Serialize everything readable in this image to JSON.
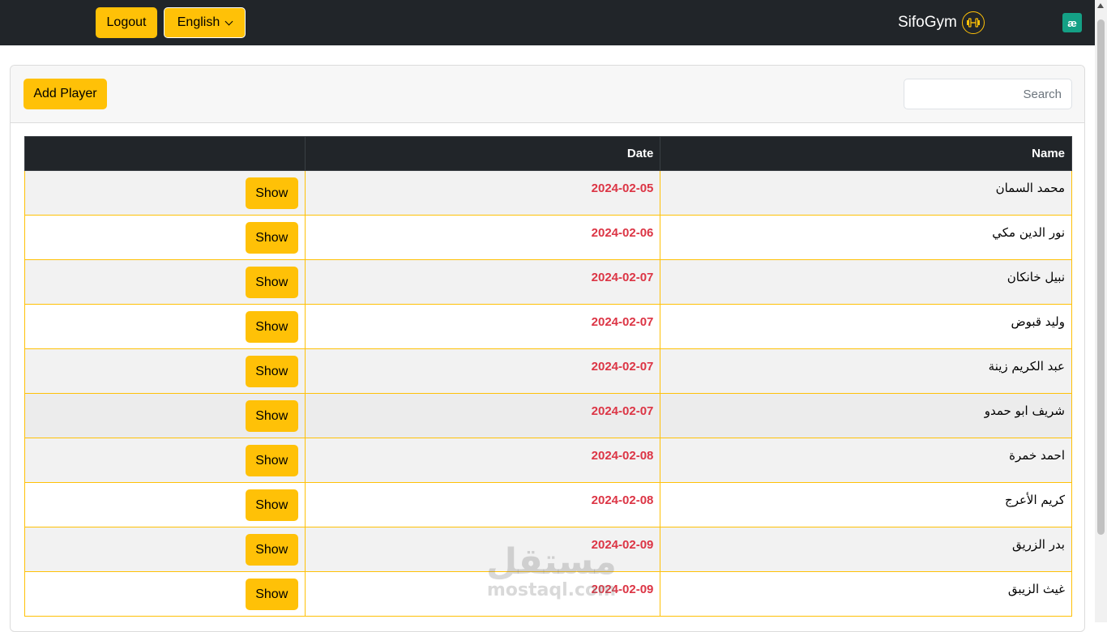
{
  "navbar": {
    "logout_label": "Logout",
    "language_label": "English",
    "brand_name": "SifoGym",
    "brand_icon": "dumbbell-icon",
    "corner_icon": "extension-icon"
  },
  "toolbar": {
    "add_player_label": "Add Player",
    "search_placeholder": "Search"
  },
  "table": {
    "headers": {
      "action": "",
      "date": "Date",
      "name": "Name"
    },
    "show_label": "Show",
    "rows": [
      {
        "name": "محمد السمان",
        "date": "2024-02-05"
      },
      {
        "name": "نور الدين مكي",
        "date": "2024-02-06"
      },
      {
        "name": "نبيل خانكان",
        "date": "2024-02-07"
      },
      {
        "name": "وليد قبوض",
        "date": "2024-02-07"
      },
      {
        "name": "عبد الكريم زينة",
        "date": "2024-02-07"
      },
      {
        "name": "شريف ابو حمدو",
        "date": "2024-02-07"
      },
      {
        "name": "احمد خمرة",
        "date": "2024-02-08"
      },
      {
        "name": "كريم الأعرج",
        "date": "2024-02-08"
      },
      {
        "name": "بدر الزريق",
        "date": "2024-02-09"
      },
      {
        "name": "غيث الزيبق",
        "date": "2024-02-09"
      }
    ]
  },
  "watermark": {
    "arabic": "مستقل",
    "latin": "mostaql.com"
  },
  "colors": {
    "accent": "#ffc107",
    "navbar": "#212529",
    "date": "#dc3545"
  }
}
